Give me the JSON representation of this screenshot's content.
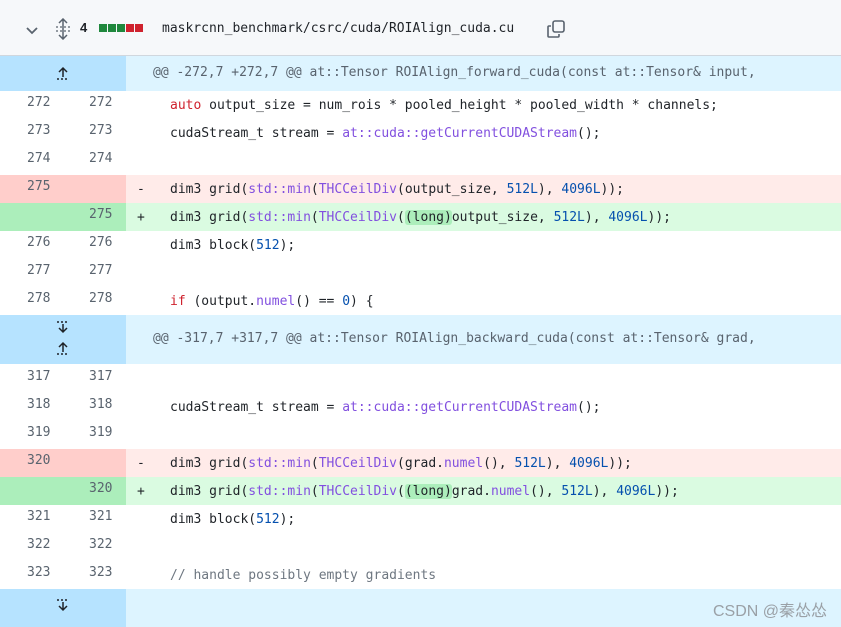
{
  "header": {
    "changes_count": "4",
    "diffstat_colors": [
      "#1f883d",
      "#1f883d",
      "#1f883d",
      "#cf222e",
      "#cf222e"
    ],
    "filename": "maskrcnn_benchmark/csrc/cuda/ROIAlign_cuda.cu"
  },
  "hunks": [
    {
      "text": "@@ -272,7 +272,7 @@ at::Tensor ROIAlign_forward_cuda(const at::Tensor& input,"
    },
    {
      "text": "@@ -317,7 +317,7 @@ at::Tensor ROIAlign_backward_cuda(const at::Tensor& grad,"
    }
  ],
  "lines": [
    {
      "old": "272",
      "new": "272",
      "marker": ""
    },
    {
      "old": "273",
      "new": "273",
      "marker": ""
    },
    {
      "old": "274",
      "new": "274",
      "marker": ""
    },
    {
      "old": "275",
      "new": "",
      "marker": "-"
    },
    {
      "old": "",
      "new": "275",
      "marker": "+"
    },
    {
      "old": "276",
      "new": "276",
      "marker": ""
    },
    {
      "old": "277",
      "new": "277",
      "marker": ""
    },
    {
      "old": "278",
      "new": "278",
      "marker": ""
    },
    {
      "old": "317",
      "new": "317",
      "marker": ""
    },
    {
      "old": "318",
      "new": "318",
      "marker": ""
    },
    {
      "old": "319",
      "new": "319",
      "marker": ""
    },
    {
      "old": "320",
      "new": "",
      "marker": "-"
    },
    {
      "old": "",
      "new": "320",
      "marker": "+"
    },
    {
      "old": "321",
      "new": "321",
      "marker": ""
    },
    {
      "old": "322",
      "new": "322",
      "marker": ""
    },
    {
      "old": "323",
      "new": "323",
      "marker": ""
    }
  ],
  "code": {
    "l272": [
      "auto",
      " output_size = num_rois * pooled_height * pooled_width * channels;"
    ],
    "l273": [
      "cudaStream_t stream = ",
      "at::cuda::",
      "getCurrentCUDAStream",
      "();"
    ],
    "l275_del": [
      "dim3 grid(",
      "std::min",
      "(",
      "THCCeilDiv",
      "(output_size, ",
      "512L",
      "), ",
      "4096L",
      "));"
    ],
    "l275_add": [
      "dim3 grid(",
      "std::min",
      "(",
      "THCCeilDiv",
      "(",
      "(long)",
      "output_size, ",
      "512L",
      "), ",
      "4096L",
      "));"
    ],
    "l276": [
      "dim3 block(",
      "512",
      ");"
    ],
    "l278": [
      "if",
      " (output.",
      "numel",
      "() == ",
      "0",
      ") {"
    ],
    "l318": [
      "cudaStream_t stream = ",
      "at::cuda::",
      "getCurrentCUDAStream",
      "();"
    ],
    "l320_del": [
      "dim3 grid(",
      "std::min",
      "(",
      "THCCeilDiv",
      "(grad.",
      "numel",
      "(), ",
      "512L",
      "), ",
      "4096L",
      "));"
    ],
    "l320_add": [
      "dim3 grid(",
      "std::min",
      "(",
      "THCCeilDiv",
      "(",
      "(long)",
      "grad.",
      "numel",
      "(), ",
      "512L",
      "), ",
      "4096L",
      "));"
    ],
    "l321": [
      "dim3 block(",
      "512",
      ");"
    ],
    "l323": "// handle possibly empty gradients"
  },
  "watermark": "CSDN @秦怂怂"
}
